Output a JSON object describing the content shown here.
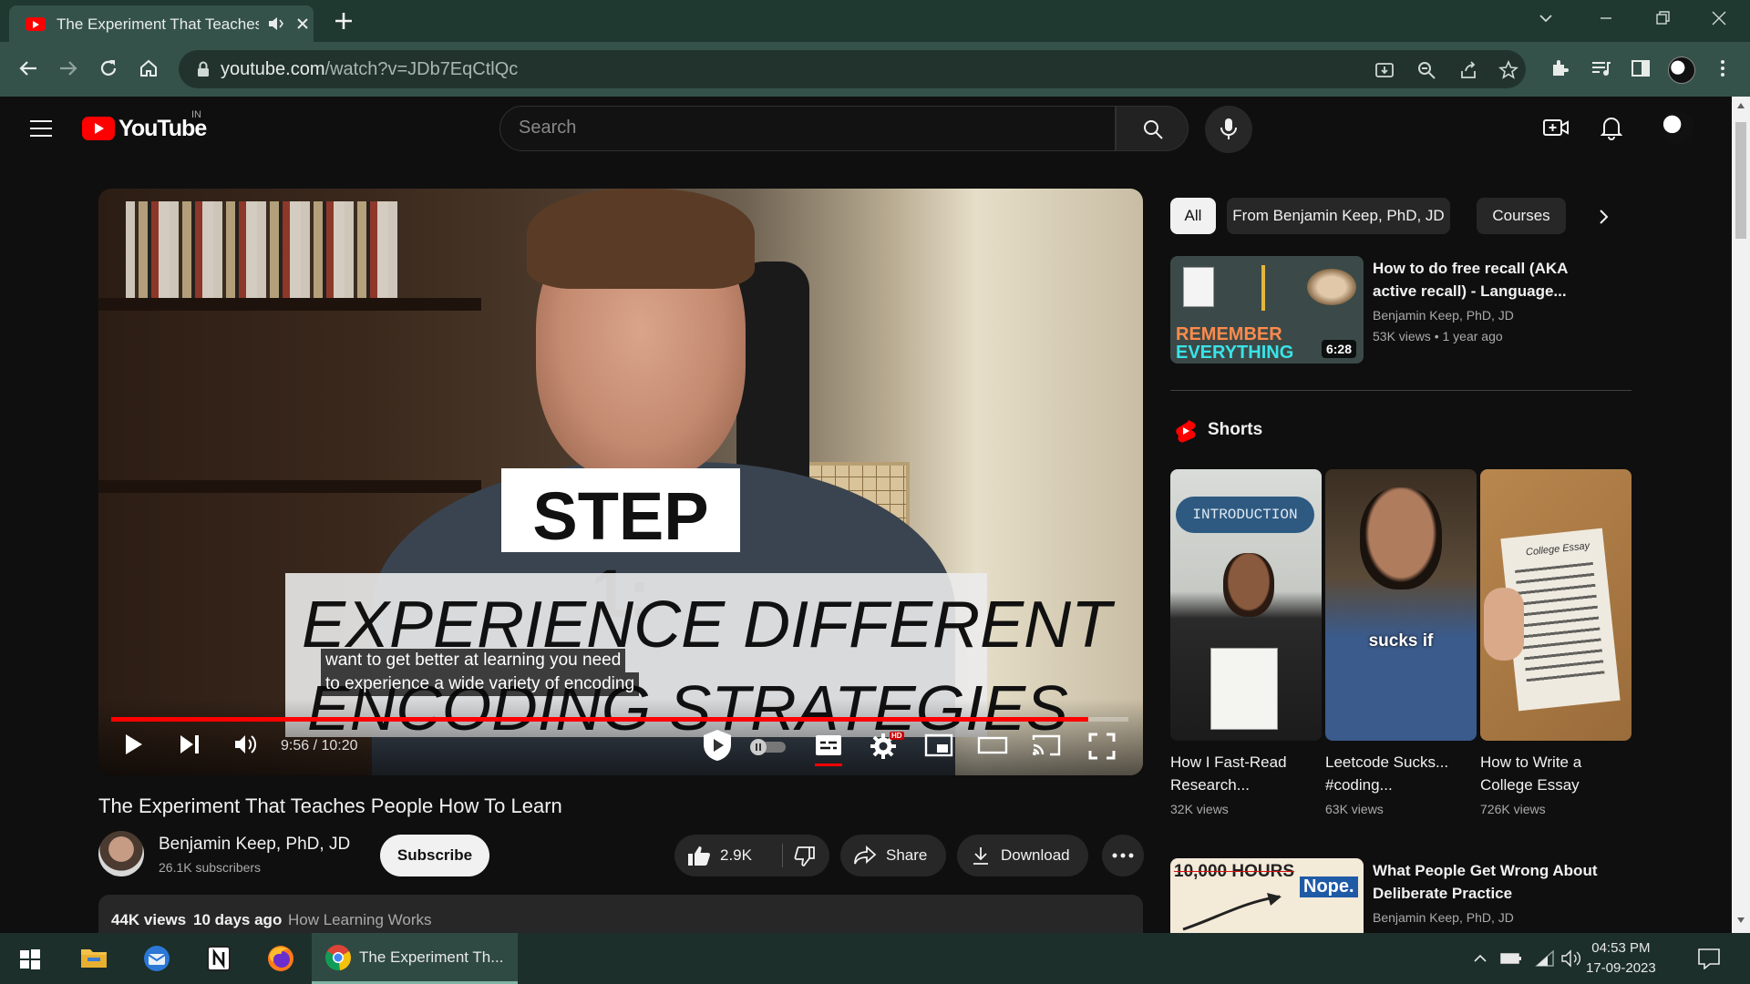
{
  "browser": {
    "tab_title": "The Experiment That Teaches",
    "url_host": "youtube.com",
    "url_path": "/watch?v=JDb7EqCtlQc"
  },
  "masthead": {
    "logo_text": "YouTube",
    "region": "IN",
    "search_placeholder": "Search"
  },
  "player": {
    "overlay_step": "STEP 1:",
    "overlay_line1": "EXPERIENCE DIFFERENT",
    "overlay_line2": "ENCODING STRATEGIES",
    "caption_line1": "want to get better at learning you need",
    "caption_line2": "to experience a wide variety of encoding",
    "time_display": "9:56 / 10:20",
    "progress": 0.961,
    "hd_badge": "HD"
  },
  "video": {
    "title": "The Experiment That Teaches People How To Learn",
    "channel": "Benjamin Keep, PhD, JD",
    "subscribers": "26.1K subscribers",
    "subscribe_label": "Subscribe",
    "likes": "2.9K",
    "share_label": "Share",
    "download_label": "Download"
  },
  "description": {
    "views": "44K views",
    "age": "10 days ago",
    "tags": "How Learning Works"
  },
  "chips": [
    "All",
    "From Benjamin Keep, PhD, JD",
    "Courses"
  ],
  "recommendations": [
    {
      "title_line1": "How to do free recall (AKA",
      "title_line2": "active recall) - Language...",
      "channel": "Benjamin Keep, PhD, JD",
      "meta": "53K views  • 1 year ago",
      "duration": "6:28",
      "thumb_text1": "REMEMBER",
      "thumb_text2": "EVERYTHING"
    },
    {
      "title_line1": "What People Get Wrong About",
      "title_line2": "Deliberate Practice",
      "channel": "Benjamin Keep, PhD, JD",
      "thumb_text1": "10,000 HOURS",
      "thumb_text2": "Nope."
    }
  ],
  "shorts": {
    "label": "Shorts",
    "items": [
      {
        "title_line1": "How I Fast-Read",
        "title_line2": "Research...",
        "views": "32K views",
        "badge": "INTRODUCTION"
      },
      {
        "title_line1": "Leetcode Sucks...",
        "title_line2": "#coding...",
        "views": "63K views",
        "badge": "sucks if"
      },
      {
        "title_line1": "How to Write a",
        "title_line2": "College Essay",
        "views": "726K views",
        "badge": "College Essay"
      }
    ]
  },
  "taskbar": {
    "chrome_label": "The Experiment Th...",
    "time": "04:53 PM",
    "date": "17-09-2023"
  }
}
